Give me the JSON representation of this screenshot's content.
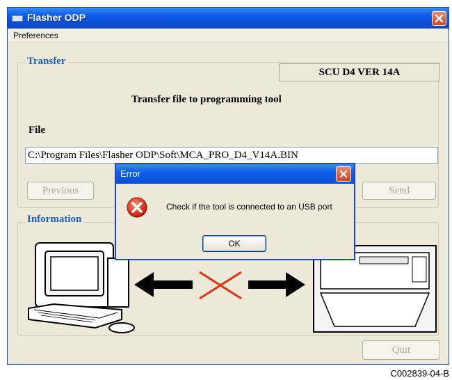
{
  "window": {
    "title": "Flasher ODP",
    "close_icon": "close-icon"
  },
  "menu": {
    "items": [
      "Preferences"
    ]
  },
  "transfer": {
    "legend": "Transfer",
    "version_label": "SCU D4 VER  14A",
    "heading": "Transfer file to programming tool",
    "file_label": "File",
    "file_path": "C:\\Program Files\\Flasher ODP\\Soft\\MCA_PRO_D4_V14A.BIN",
    "previous_button": "Previous",
    "send_button": "Send"
  },
  "information": {
    "legend": "Information",
    "illustration": {
      "left": "computer-icon",
      "middle": "arrows-with-red-cross-icon",
      "right": "programming-tool-icon"
    }
  },
  "quit_button": "Quit",
  "error_dialog": {
    "title": "Error",
    "icon": "error-icon",
    "message": "Check if the tool is connected to an USB port",
    "ok_button": "OK"
  },
  "caption": "C002839-04-B"
}
